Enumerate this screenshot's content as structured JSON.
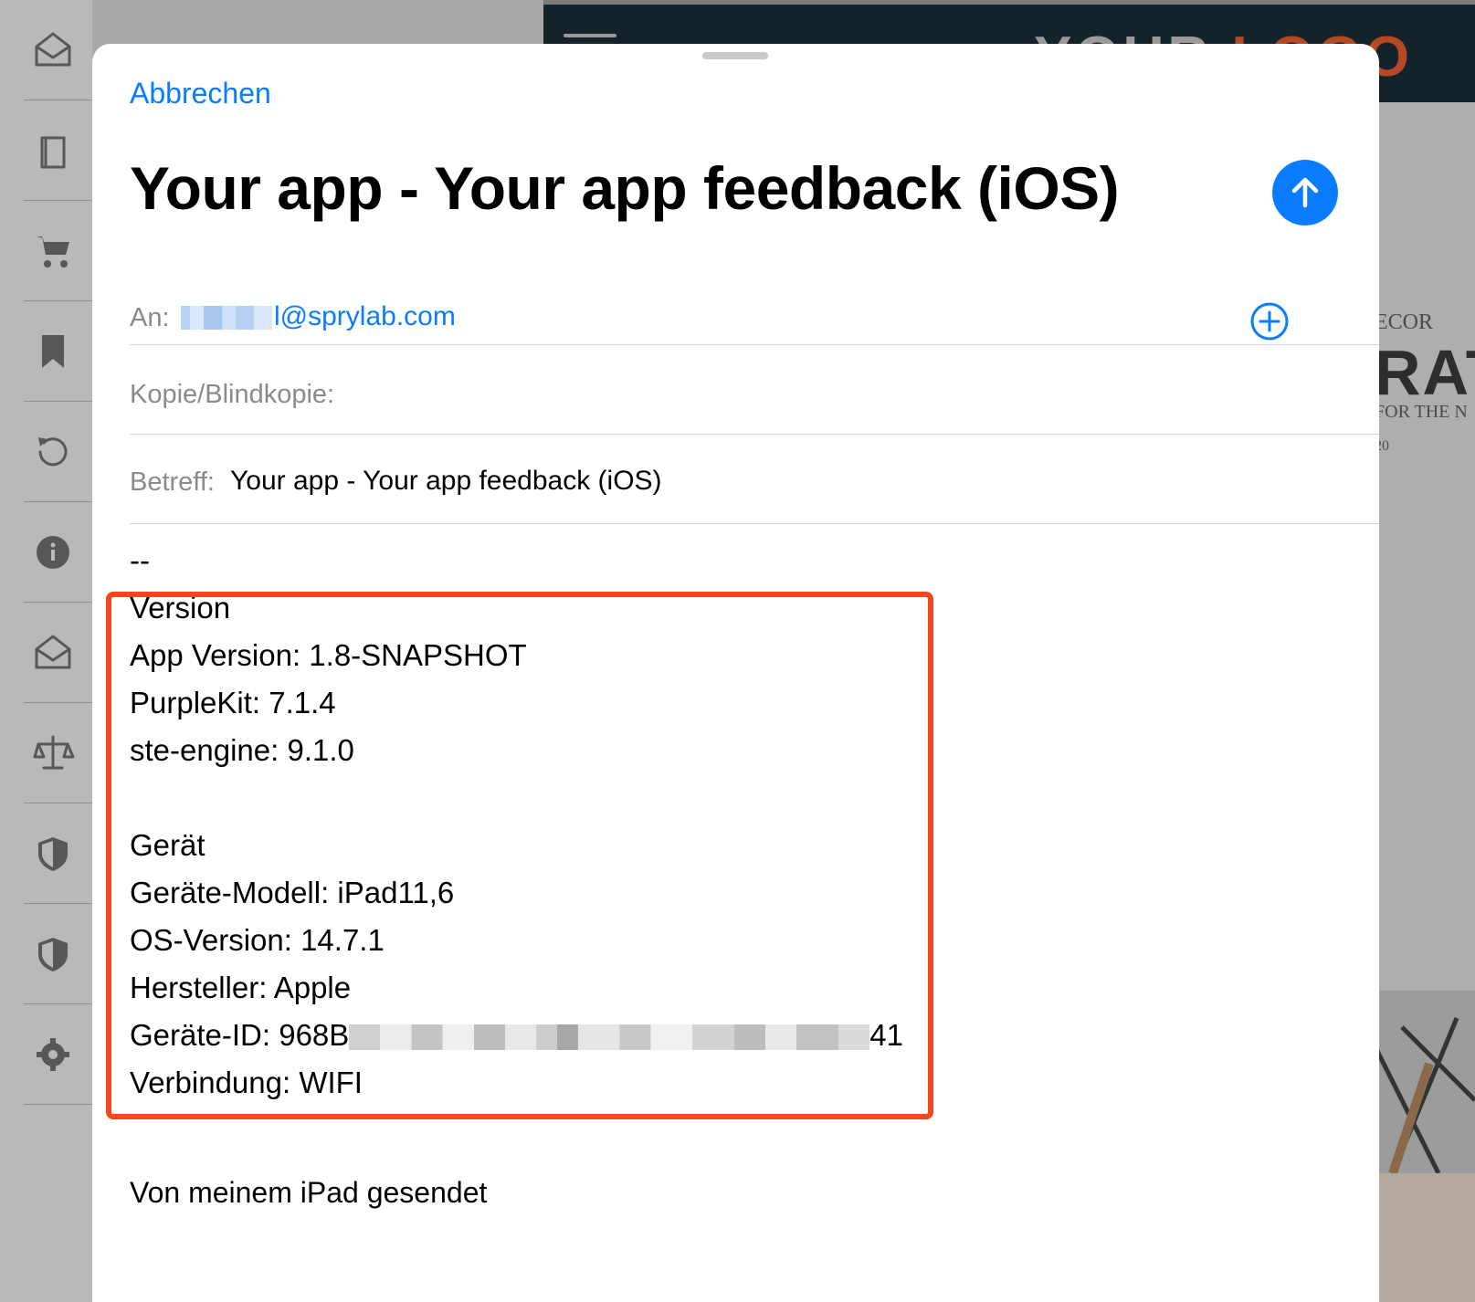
{
  "background": {
    "sidebar_items": [
      "inbox-icon",
      "book-icon",
      "cart-icon",
      "bookmark-icon",
      "refresh-icon",
      "info-icon",
      "mail-open-icon",
      "scale-icon",
      "shield-icon",
      "shield-icon",
      "gear-icon"
    ],
    "web_logo_a": "YOUR ",
    "web_logo_b": "LOGO",
    "hero_line1": "ECOR",
    "hero_line2": "RATI",
    "hero_line3": "FOR THE N",
    "hero_line4": "20"
  },
  "compose": {
    "cancel_label": "Abbrechen",
    "title": "Your app - Your app feedback (iOS)",
    "send_icon": "arrow-up-icon",
    "to_label": "An:",
    "to_value_visible": "l@sprylab.com",
    "add_recipient_icon": "plus-circle-icon",
    "cc_label": "Kopie/Blindkopie:",
    "subject_label": "Betreff:",
    "subject_value": "Your app - Your app feedback (iOS)"
  },
  "body": {
    "separator": "--",
    "version_heading": "Version",
    "app_version": "App Version: 1.8-SNAPSHOT",
    "purplekit": "PurpleKit: 7.1.4",
    "ste_engine": "ste-engine: 9.1.0",
    "device_heading": "Gerät",
    "device_model": "Geräte-Modell: iPad11,6",
    "os_version": "OS-Version: 14.7.1",
    "manufacturer": "Hersteller: Apple",
    "device_id_prefix": "Geräte-ID: 968B",
    "device_id_suffix": "41",
    "connection": "Verbindung: WIFI",
    "signature": "Von meinem iPad gesendet"
  },
  "colors": {
    "accent": "#0a7cff",
    "highlight": "#f4461f"
  }
}
